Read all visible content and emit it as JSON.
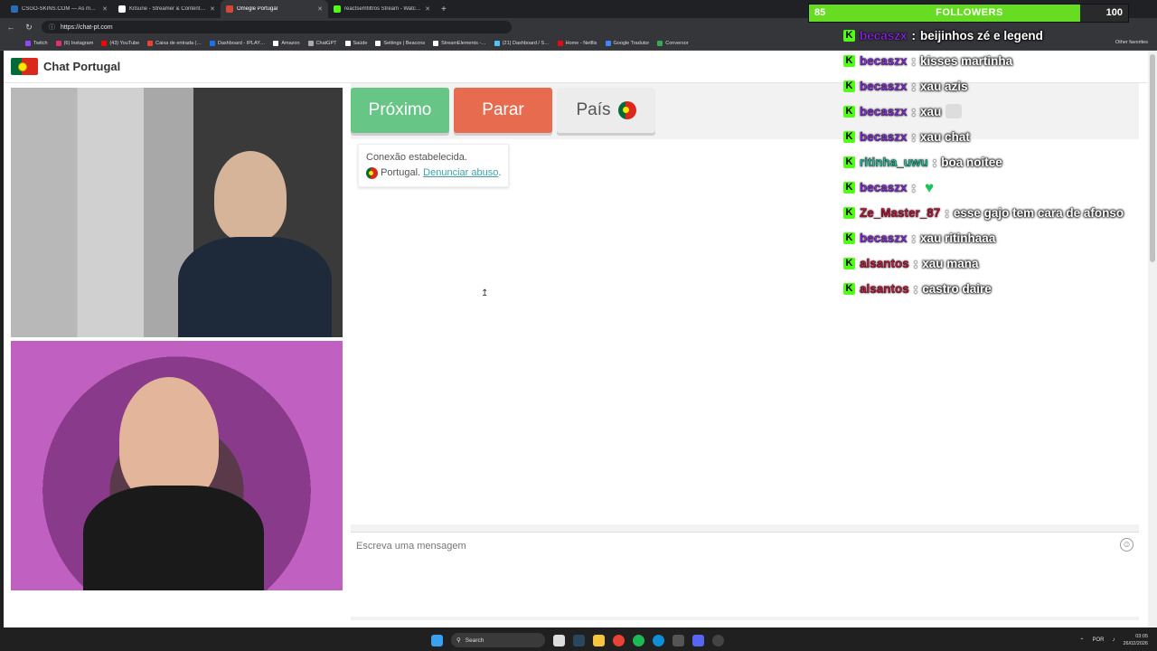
{
  "browser": {
    "tabs": [
      {
        "label": "CSGO-SKINS.COM — As melhore…",
        "color": "#2b6cb0"
      },
      {
        "label": "Kitsune - Streamer & Content Cre…",
        "color": "#ffffff"
      },
      {
        "label": "Omegle Portugal",
        "color": "#d24a35"
      },
      {
        "label": "reactsemfiltros Stream - Watch Li…",
        "color": "#53fc18"
      }
    ],
    "url": "https://chat-pt.com",
    "bookmarks": [
      {
        "label": "Twitch",
        "color": "#9146ff"
      },
      {
        "label": "(6) Instagram",
        "color": "#e1306c"
      },
      {
        "label": "(43) YouTube",
        "color": "#ff0000"
      },
      {
        "label": "Caixa de entrada (…",
        "color": "#ea4335"
      },
      {
        "label": "Dashboard - IPLAY…",
        "color": "#1a73e8"
      },
      {
        "label": "Amazon",
        "color": "#ffffff"
      },
      {
        "label": "ChatGPT",
        "color": "#aaaaaa"
      },
      {
        "label": "Saúde",
        "color": "#ffffff"
      },
      {
        "label": "Settings | Beacons",
        "color": "#ffffff"
      },
      {
        "label": "StreamElements -…",
        "color": "#ffffff"
      },
      {
        "label": "(21) Dashboard / S…",
        "color": "#4fc3f7"
      },
      {
        "label": "Home - Netflix",
        "color": "#e50914"
      },
      {
        "label": "Google Tradutor",
        "color": "#4285f4"
      },
      {
        "label": "Conversor",
        "color": "#34a853"
      }
    ],
    "other_favorites": "Other favorites"
  },
  "site": {
    "title": "Chat Portugal",
    "buttons": {
      "next": "Próximo",
      "stop": "Parar",
      "country": "País"
    },
    "system_message": {
      "line1": "Conexão estabelecida.",
      "country": "Portugal.",
      "report": "Denunciar abuso"
    },
    "input_placeholder": "Escreva uma mensagem"
  },
  "stream_overlay": {
    "followers": {
      "current": 85,
      "label": "FOLLOWERS",
      "goal": 100,
      "progress": 0.85
    },
    "messages": [
      {
        "user": "becaszx",
        "color": "#8a2be2",
        "text": "beijinhos zé e legend"
      },
      {
        "user": "becaszx",
        "color": "#8a2be2",
        "text": "kisses martinha"
      },
      {
        "user": "becaszx",
        "color": "#8a2be2",
        "text": "xau azis"
      },
      {
        "user": "becaszx",
        "color": "#8a2be2",
        "text": "xau",
        "emote": "cat"
      },
      {
        "user": "becaszx",
        "color": "#8a2be2",
        "text": "xau chat"
      },
      {
        "user": "ritinha_uwu",
        "color": "#1ec3a0",
        "text": "boa noitee"
      },
      {
        "user": "becaszx",
        "color": "#8a2be2",
        "text": "",
        "emote": "heart"
      },
      {
        "user": "Ze_Master_87",
        "color": "#c4123a",
        "text": "esse gajo tem cara de afonso"
      },
      {
        "user": "becaszx",
        "color": "#8a2be2",
        "text": "xau ritinhaaa"
      },
      {
        "user": "alsantos",
        "color": "#c4123a",
        "text": "xau mana"
      },
      {
        "user": "alsantos",
        "color": "#c4123a",
        "text": "castro daire"
      }
    ]
  },
  "taskbar": {
    "search": "Search",
    "lang": "POR",
    "time": "03:05",
    "date": "26/02/2026"
  }
}
